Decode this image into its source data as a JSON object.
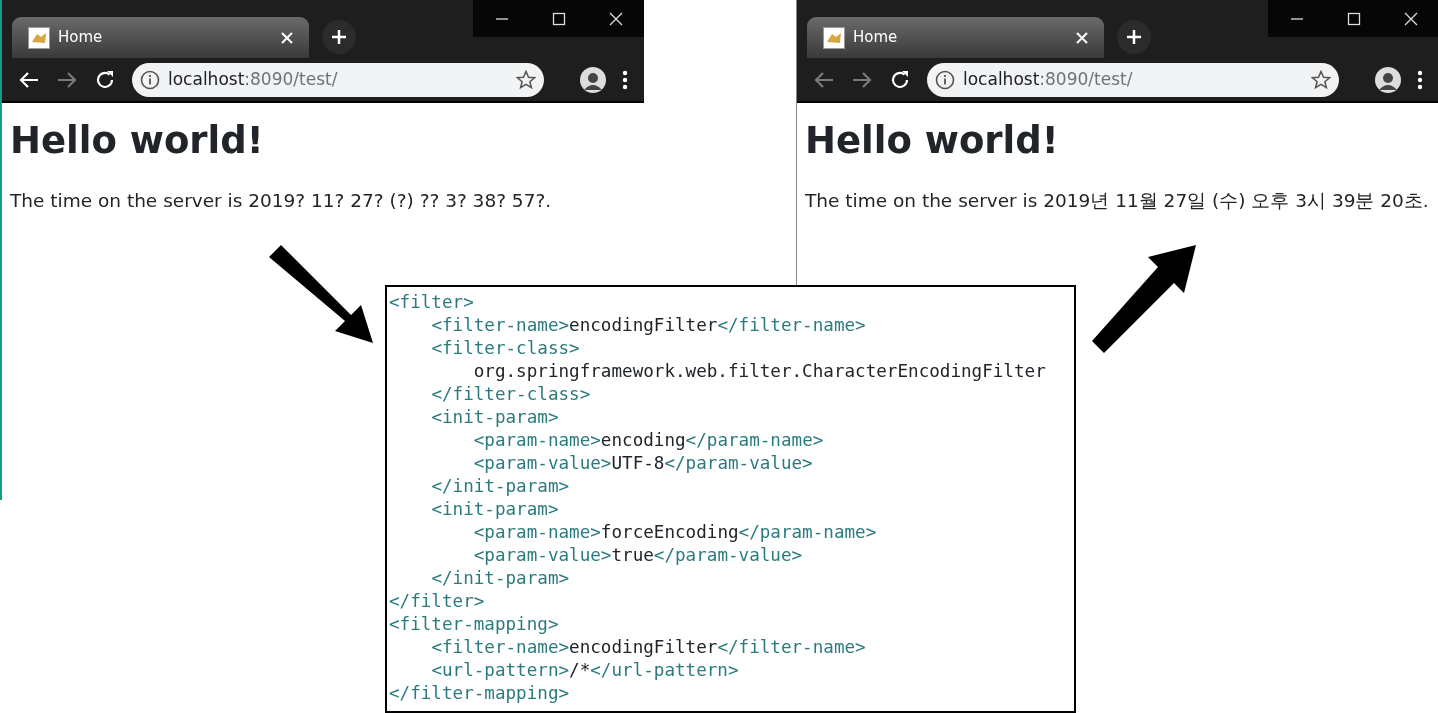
{
  "windows": [
    {
      "tab_title": "Home",
      "url_host": "localhost",
      "url_rest": ":8090/test/",
      "back_enabled": true,
      "forward_enabled": false,
      "heading": "Hello world!",
      "body_text": "The time on the server is 2019? 11? 27? (?) ?? 3? 38? 57?."
    },
    {
      "tab_title": "Home",
      "url_host": "localhost",
      "url_rest": ":8090/test/",
      "back_enabled": false,
      "forward_enabled": false,
      "heading": "Hello world!",
      "body_text": "The time on the server is 2019년 11월 27일 (수) 오후 3시 39분 20초."
    }
  ],
  "code": [
    {
      "kind": "block",
      "tag_open": "<filter>",
      "tag_close": "</filter>",
      "children": [
        {
          "kind": "inline",
          "tag_open": "<filter-name>",
          "value": "encodingFilter",
          "tag_close": "</filter-name>"
        },
        {
          "kind": "block",
          "tag_open": "<filter-class>",
          "tag_close": "</filter-class>",
          "children": [
            {
              "kind": "text",
              "value": "org.springframework.web.filter.CharacterEncodingFilter"
            }
          ]
        },
        {
          "kind": "block",
          "tag_open": "<init-param>",
          "tag_close": "</init-param>",
          "children": [
            {
              "kind": "inline",
              "tag_open": "<param-name>",
              "value": "encoding",
              "tag_close": "</param-name>"
            },
            {
              "kind": "inline",
              "tag_open": "<param-value>",
              "value": "UTF-8",
              "tag_close": "</param-value>"
            }
          ]
        },
        {
          "kind": "block",
          "tag_open": "<init-param>",
          "tag_close": "</init-param>",
          "children": [
            {
              "kind": "inline",
              "tag_open": "<param-name>",
              "value": "forceEncoding",
              "tag_close": "</param-name>"
            },
            {
              "kind": "inline",
              "tag_open": "<param-value>",
              "value": "true",
              "tag_close": "</param-value>"
            }
          ]
        }
      ]
    },
    {
      "kind": "block",
      "tag_open": "<filter-mapping>",
      "tag_close": "</filter-mapping>",
      "children": [
        {
          "kind": "inline",
          "tag_open": "<filter-name>",
          "value": "encodingFilter",
          "tag_close": "</filter-name>"
        },
        {
          "kind": "inline",
          "tag_open": "<url-pattern>",
          "value": "/*",
          "tag_close": "</url-pattern>"
        }
      ]
    }
  ]
}
